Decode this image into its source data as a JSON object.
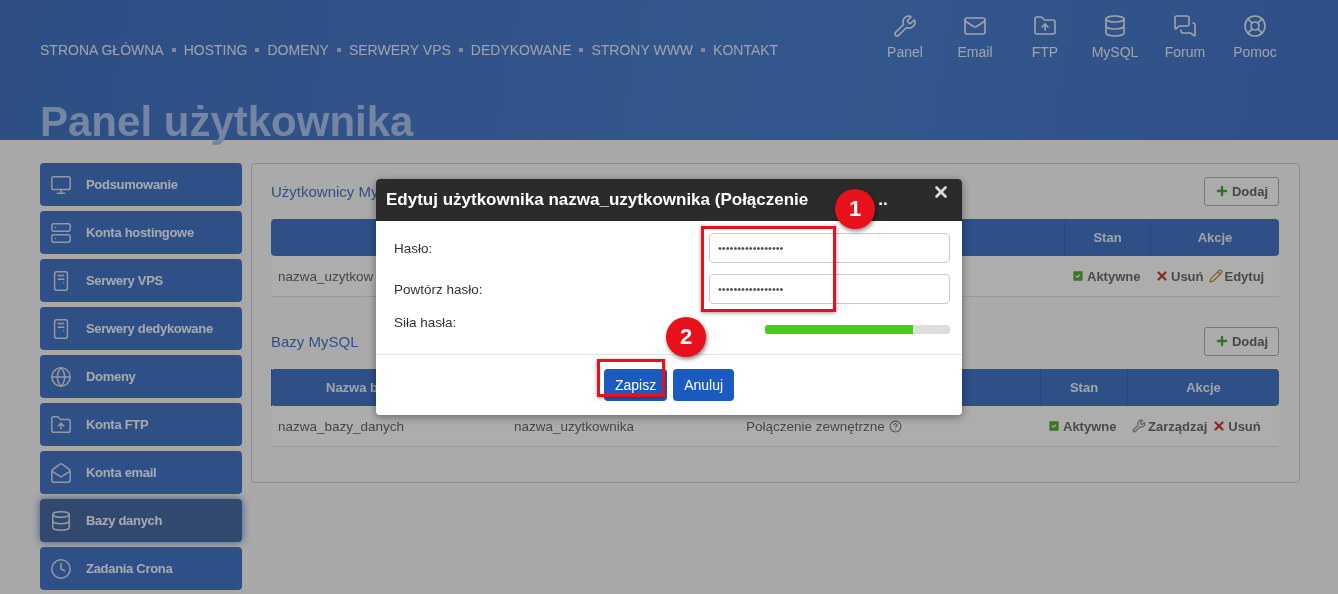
{
  "nav": {
    "links": [
      "STRONA GŁÓWNA",
      "HOSTING",
      "DOMENY",
      "SERWERY VPS",
      "DEDYKOWANE",
      "STRONY WWW",
      "KONTAKT"
    ],
    "shortcuts": [
      {
        "kind": "tools",
        "label": "Panel"
      },
      {
        "kind": "mail",
        "label": "Email"
      },
      {
        "kind": "folder",
        "label": "FTP"
      },
      {
        "kind": "database",
        "label": "MySQL"
      },
      {
        "kind": "chat",
        "label": "Forum"
      },
      {
        "kind": "help",
        "label": "Pomoc"
      }
    ]
  },
  "page_title": "Panel użytkownika",
  "sidebar": {
    "items": [
      {
        "kind": "monitor",
        "label": "Podsumowanie",
        "selected": false
      },
      {
        "kind": "servers",
        "label": "Konta hostingowe",
        "selected": false
      },
      {
        "kind": "tower",
        "label": "Serwery VPS",
        "selected": false
      },
      {
        "kind": "tower",
        "label": "Serwery dedykowane",
        "selected": false
      },
      {
        "kind": "globe",
        "label": "Domeny",
        "selected": false
      },
      {
        "kind": "folder",
        "label": "Konta FTP",
        "selected": false
      },
      {
        "kind": "mail",
        "label": "Konta email",
        "selected": false
      },
      {
        "kind": "database",
        "label": "Bazy danych",
        "selected": true
      },
      {
        "kind": "clock",
        "label": "Zadania Crona",
        "selected": false
      }
    ]
  },
  "users_section": {
    "title": "Użytkownicy My",
    "add_button": "Dodaj",
    "columns": [
      "Stan",
      "Akcje"
    ],
    "rows": [
      {
        "name": "nazwa_uzytkow",
        "status": "Aktywne",
        "actions": [
          {
            "kind": "delete",
            "label": "Usuń"
          },
          {
            "kind": "edit",
            "label": "Edytuj"
          }
        ]
      }
    ]
  },
  "databases_section": {
    "title": "Bazy MySQL",
    "add_button": "Dodaj",
    "columns": [
      "Nazwa b",
      "Stan",
      "Akcje"
    ],
    "rows": [
      {
        "name": "nazwa_bazy_danych",
        "user": "nazwa_uzytkownika",
        "connection": "Połączenie zewnętrzne",
        "status": "Aktywne",
        "actions": [
          {
            "kind": "manage",
            "label": "Zarządzaj"
          },
          {
            "kind": "delete",
            "label": "Usuń"
          }
        ]
      }
    ]
  },
  "dialog": {
    "title": "Edytuj użytkownika nazwa_uzytkownika (Połączenie",
    "title_tail": "..",
    "fields": [
      {
        "label": "Hasło:",
        "value": "•••••••••••••••••"
      },
      {
        "label": "Powtórz hasło:",
        "value": "•••••••••••••••••"
      }
    ],
    "strength": {
      "label": "Siła hasła:",
      "level": 0.8
    },
    "buttons": [
      "Zapisz",
      "Anuluj"
    ]
  },
  "annotations": [
    {
      "kind": "frame"
    },
    {
      "kind": "badge",
      "text": "1"
    },
    {
      "kind": "frame"
    },
    {
      "kind": "badge",
      "text": "2"
    }
  ]
}
